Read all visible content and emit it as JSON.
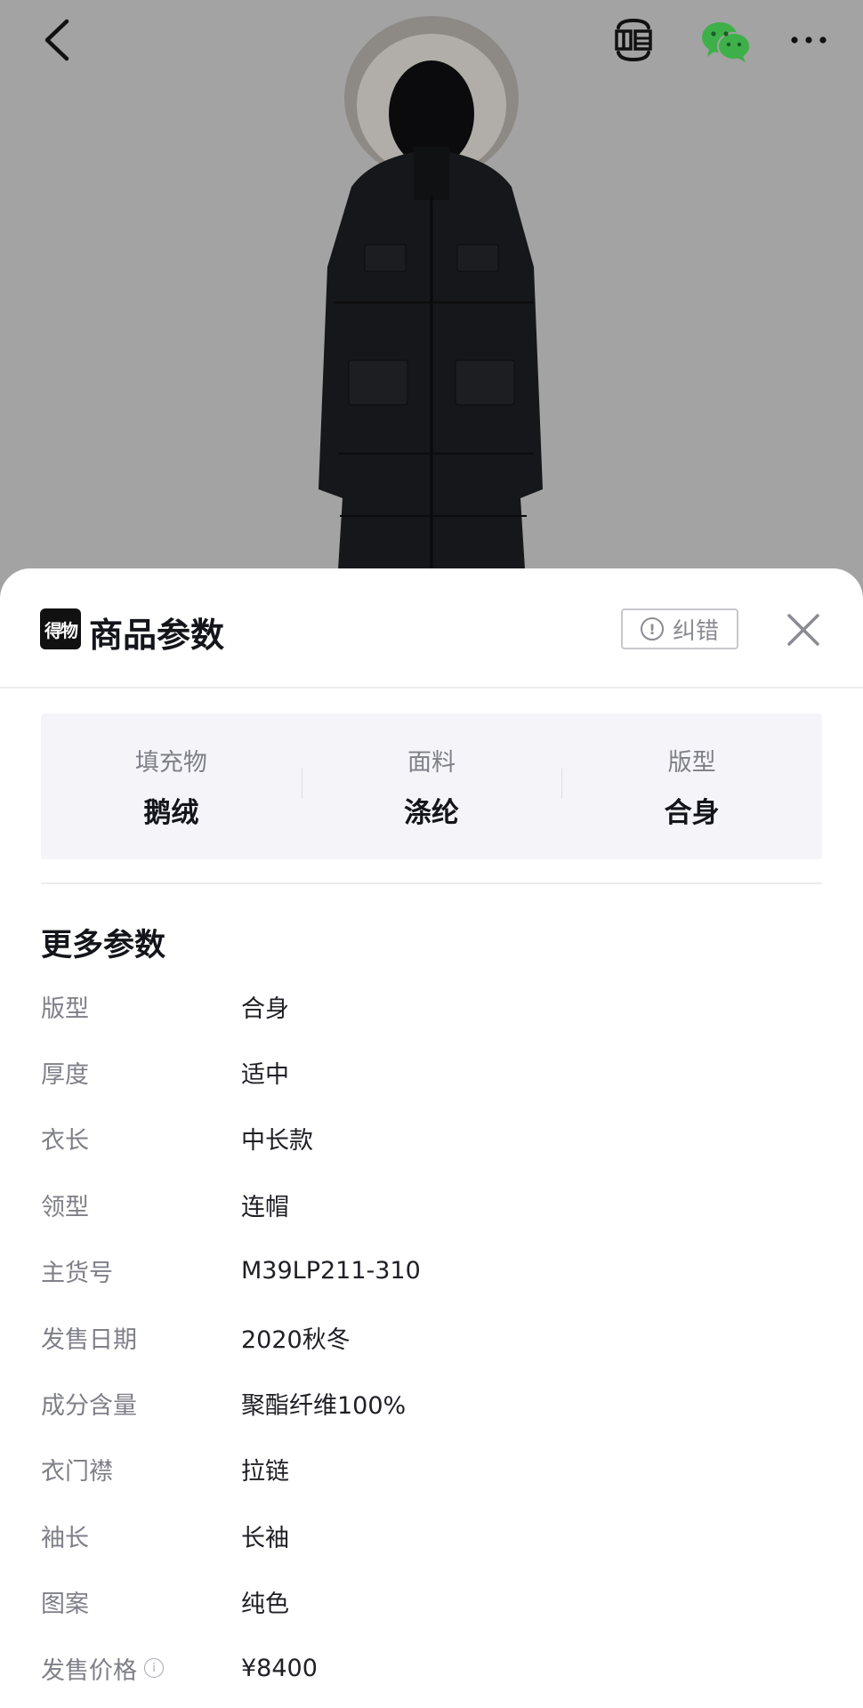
{
  "sheet": {
    "brand_logo_text": "得物",
    "title": "商品参数",
    "report_label": "纠错"
  },
  "key_params": [
    {
      "label": "填充物",
      "value": "鹅绒"
    },
    {
      "label": "面料",
      "value": "涤纶"
    },
    {
      "label": "版型",
      "value": "合身"
    }
  ],
  "more_params": {
    "title": "更多参数",
    "rows": [
      {
        "label": "版型",
        "value": "合身"
      },
      {
        "label": "厚度",
        "value": "适中"
      },
      {
        "label": "衣长",
        "value": "中长款"
      },
      {
        "label": "领型",
        "value": "连帽"
      },
      {
        "label": "主货号",
        "value": "M39LP211-310"
      },
      {
        "label": "发售日期",
        "value": "2020秋冬"
      },
      {
        "label": "成分含量",
        "value": "聚酯纤维100%"
      },
      {
        "label": "衣门襟",
        "value": "拉链"
      },
      {
        "label": "袖长",
        "value": "长袖"
      },
      {
        "label": "图案",
        "value": "纯色"
      },
      {
        "label": "发售价格",
        "value": "¥8400"
      }
    ]
  },
  "icons": {
    "back": "chevron-left-icon",
    "sell": "sell-icon",
    "wechat": "wechat-icon",
    "more": "more-dots-icon",
    "close": "close-icon",
    "info": "info-icon"
  },
  "colors": {
    "background_gray": "#a3a3a3",
    "sheet_white": "#ffffff",
    "wechat_green": "#3eb049",
    "card_bg": "#f5f5f9",
    "muted_text": "#7f7f88"
  }
}
